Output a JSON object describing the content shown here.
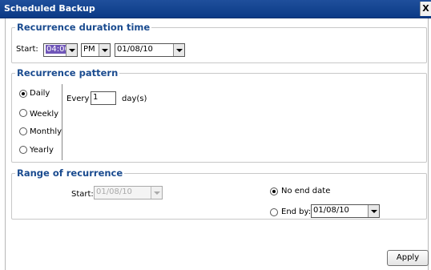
{
  "window": {
    "title": "Scheduled Backup",
    "close_label": "X"
  },
  "duration": {
    "legend": "Recurrence duration time",
    "start_label": "Start:",
    "time_value": "04:00",
    "ampm_value": "PM",
    "date_value": "01/08/10"
  },
  "pattern": {
    "legend": "Recurrence pattern",
    "options": [
      {
        "label": "Daily",
        "checked": true
      },
      {
        "label": "Weekly",
        "checked": false
      },
      {
        "label": "Monthly",
        "checked": false
      },
      {
        "label": "Yearly",
        "checked": false
      }
    ],
    "every_label": "Every",
    "every_value": "1",
    "unit_label": "day(s)"
  },
  "range": {
    "legend": "Range of recurrence",
    "start_label": "Start:",
    "start_value": "01/08/10",
    "no_end_label": "No end date",
    "end_by_label": "End by:",
    "end_by_value": "01/08/10",
    "selected": "no_end"
  },
  "apply_label": "Apply"
}
